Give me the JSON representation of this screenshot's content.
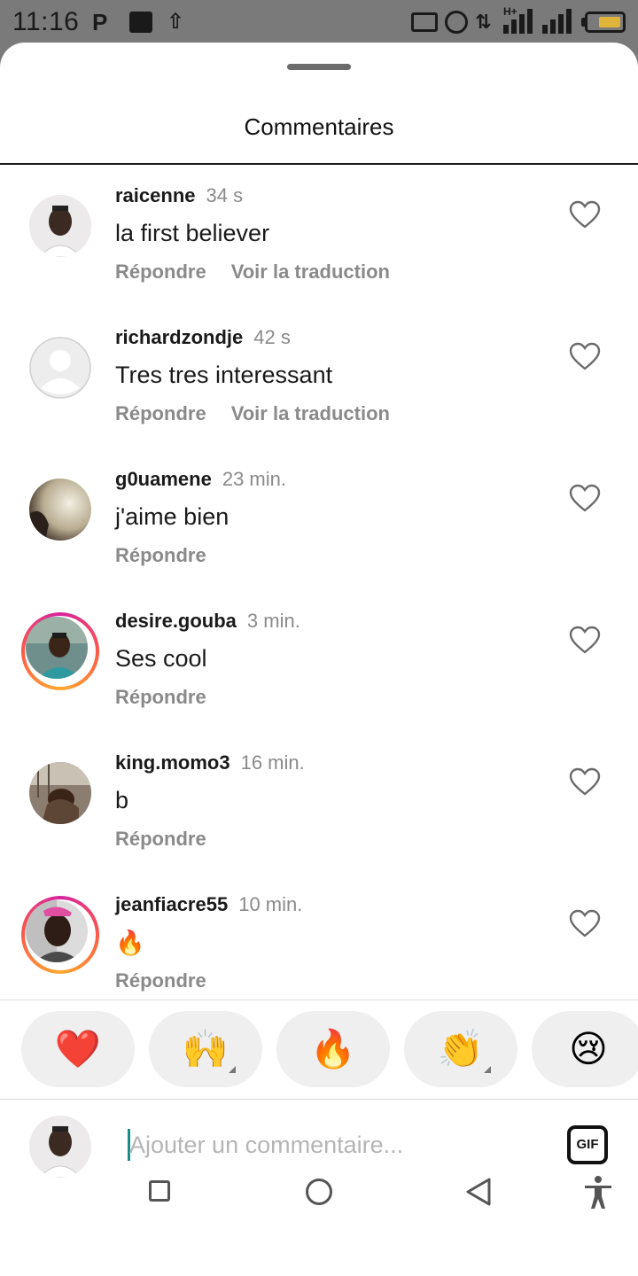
{
  "status_bar": {
    "time": "11:16",
    "p_icon": "P",
    "upload_icon": "⇧",
    "data_icon": "⇅",
    "network": "H+",
    "battery_level": 0.7
  },
  "sheet": {
    "title": "Commentaires"
  },
  "comments": [
    {
      "username": "raicenne",
      "time": "34 s",
      "text": "la first believer",
      "reply": "Répondre",
      "translate": "Voir la traduction",
      "story_ring": false
    },
    {
      "username": "richardzondje",
      "time": "42 s",
      "text": "Tres tres interessant",
      "reply": "Répondre",
      "translate": "Voir la traduction",
      "story_ring": false
    },
    {
      "username": "g0uamene",
      "time": "23 min.",
      "text": "j'aime bien",
      "reply": "Répondre",
      "story_ring": false
    },
    {
      "username": "desire.gouba",
      "time": "3 min.",
      "text": "Ses cool",
      "reply": "Répondre",
      "story_ring": true
    },
    {
      "username": "king.momo3",
      "time": "16 min.",
      "text": "b",
      "reply": "Répondre",
      "story_ring": false
    },
    {
      "username": "jeanfiacre55",
      "time": "10 min.",
      "text": "🔥",
      "reply": "Répondre",
      "story_ring": true
    }
  ],
  "reactions": [
    "❤️",
    "🙌",
    "🔥",
    "👏",
    "😢"
  ],
  "input": {
    "placeholder": "Ajouter un commentaire...",
    "gif_label": "GIF"
  },
  "icons": {
    "heart": "heart-outline-icon",
    "gif": "gif-icon",
    "nav": [
      "recents-icon",
      "home-icon",
      "back-icon",
      "accessibility-icon"
    ]
  },
  "colors": {
    "accent_caret": "#1b8a8a",
    "story_ring": [
      "#d6249f",
      "#fd5949",
      "#fdaa2f"
    ],
    "battery": "#e0b43a"
  }
}
